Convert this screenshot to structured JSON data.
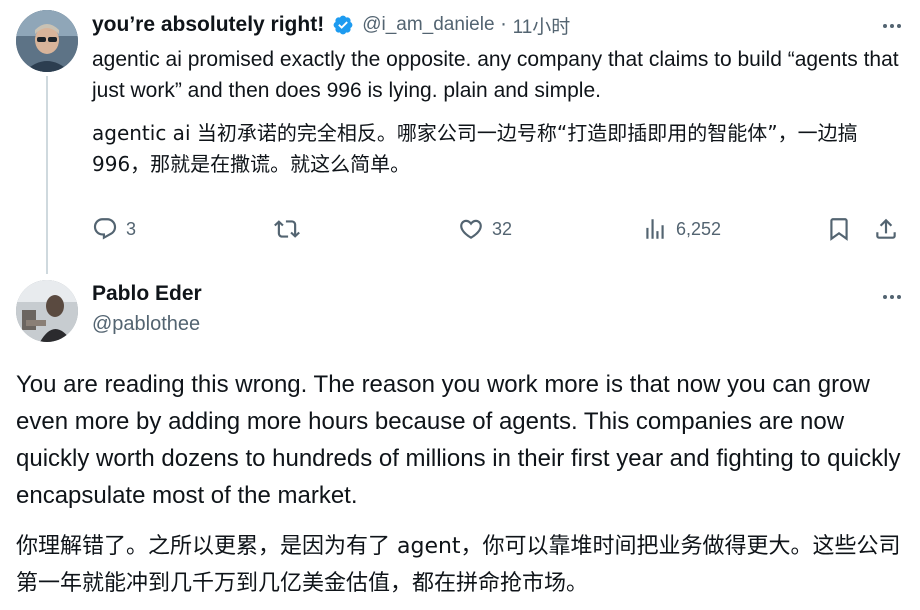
{
  "reply_to_post": {
    "author": {
      "display_name": "you’re absolutely right!",
      "verified": true,
      "handle": "@i_am_daniele",
      "separator": "·",
      "time": "11小时"
    },
    "text_en": "agentic ai promised exactly the opposite. any company that claims to build “agents that just work” and then does 996 is lying. plain and simple.",
    "text_zh": "agentic ai 当初承诺的完全相反。哪家公司一边号称“打造即插即用的智能体”，一边搞 996，那就是在撒谎。就这么简单。",
    "actions": {
      "replies": "3",
      "reposts": "",
      "likes": "32",
      "views": "6,252"
    },
    "icons": [
      "more-icon",
      "verified-badge-icon",
      "reply-icon",
      "repost-icon",
      "like-icon",
      "views-icon",
      "bookmark-icon",
      "share-icon"
    ]
  },
  "main_post": {
    "author": {
      "display_name": "Pablo Eder",
      "handle": "@pablothee"
    },
    "text_en": "You are reading this wrong. The reason you work more is that now you can grow even more by adding more hours because of agents. This companies are now quickly worth dozens to hundreds of millions in their first year and fighting to quickly encapsulate most of the market.",
    "text_zh": "你理解错了。之所以更累，是因为有了 agent，你可以靠堆时间把业务做得更大。这些公司第一年就能冲到几千万到几亿美金估值，都在拼命抢市场。"
  },
  "colors": {
    "text_primary": "#0f1419",
    "text_secondary": "#536471",
    "verified_blue": "#1d9bf0",
    "thread_line": "#cfd9de"
  }
}
